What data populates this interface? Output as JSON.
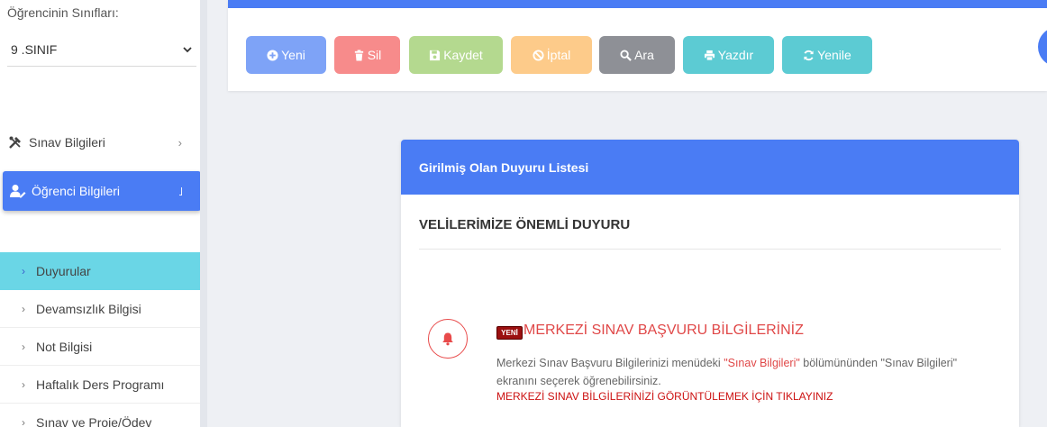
{
  "sidebar": {
    "class_label": "Öğrencinin Sınıfları:",
    "class_select_value": "9 .SINIF",
    "menu": [
      {
        "label": "Sınav Bilgileri",
        "icon": "tools-icon",
        "chevron": "›"
      },
      {
        "label": "Öğrenci Bilgileri",
        "icon": "user-edit-icon",
        "chevron": "˩"
      }
    ],
    "submenu": [
      {
        "label": "Duyurular",
        "active": true
      },
      {
        "label": "Devamsızlık Bilgisi"
      },
      {
        "label": "Not Bilgisi"
      },
      {
        "label": "Haftalık Ders Programı"
      },
      {
        "label": "Sınav ve Proje/Ödev"
      }
    ],
    "sub_chevron": "›"
  },
  "toolbar": {
    "buttons": [
      {
        "label": "Yeni",
        "icon": "plus-circle-icon",
        "color": "#7ea3f7"
      },
      {
        "label": "Sil",
        "icon": "trash-icon",
        "color": "#f78b8b"
      },
      {
        "label": "Kaydet",
        "icon": "save-icon",
        "color": "#b4d98f"
      },
      {
        "label": "İptal",
        "icon": "ban-icon",
        "color": "#fdcb8a"
      },
      {
        "label": "Ara",
        "icon": "search-icon",
        "color": "#8e9096"
      },
      {
        "label": "Yazdır",
        "icon": "print-icon",
        "color": "#5ccbd3"
      },
      {
        "label": "Yenile",
        "icon": "refresh-icon",
        "color": "#5ccbd3"
      }
    ],
    "accent": "#4a7cf4"
  },
  "announcements": {
    "header": "Girilmiş Olan Duyuru Listesi",
    "title": "VELİLERİMİZE ÖNEMLİ DUYURU",
    "item": {
      "badge": "YENİ",
      "title": "MERKEZİ SINAV BAŞVURU BİLGİLERİNİZ",
      "desc_before": "Merkezi Sınav Başvuru Bilgilerinizi menüdeki ",
      "desc_highlight": "\"Sınav Bilgileri\"",
      "desc_after": " bölümününden \"Sınav Bilgileri\" ekranını seçerek öğrenebilirsiniz.",
      "link": "MERKEZİ SINAV BİLGİLERİNİZİ GÖRÜNTÜLEMEK İÇİN TIKLAYINIZ"
    }
  }
}
